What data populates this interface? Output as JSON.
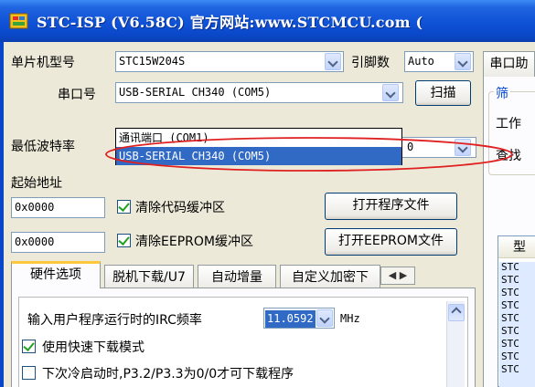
{
  "window": {
    "title": "STC-ISP (V6.58C) 官方网站:www.STCMCU.com  (",
    "title_tail": "(W"
  },
  "left": {
    "mcu_model_label": "单片机型号",
    "mcu_model_value": "STC15W204S",
    "pin_count_label": "引脚数",
    "pin_count_value": "Auto",
    "serial_port_label": "串口号",
    "serial_port_value": "USB-SERIAL CH340 (COM5)",
    "scan_button": "扫描",
    "min_baud_label": "最低波特率",
    "baud_partial": "0",
    "serial_options": [
      "通讯端口 (COM1)",
      "USB-SERIAL CH340 (COM5)"
    ],
    "start_addr_label": "起始地址",
    "addr1": "0x0000",
    "addr2": "0x0000",
    "clear_code_label": "清除代码缓冲区",
    "clear_eeprom_label": "清除EEPROM缓冲区",
    "open_prog_button": "打开程序文件",
    "open_eeprom_button": "打开EEPROM文件"
  },
  "tabs": [
    "硬件选项",
    "脱机下载/U7",
    "自动增量",
    "自定义加密下"
  ],
  "hw": {
    "irc_label": "输入用户程序运行时的IRC频率",
    "irc_value": "11.0592",
    "irc_unit": "MHz",
    "fast_download_label": "使用快速下载模式",
    "cold_start_label": "下次冷启动时,P3.2/P3.3为0/0才可下载程序"
  },
  "right": {
    "tab_label": "串口助",
    "group_label": "筛",
    "row1": "工作",
    "row2": "查找",
    "table_header": "型",
    "list_items": [
      "STC",
      "STC",
      "STC",
      "STC",
      "STC",
      "STC",
      "STC",
      "STC",
      "STC"
    ]
  },
  "colors": {
    "titlebar": "#0f52d6",
    "selection": "#316ac5",
    "annotation": "#e02020"
  }
}
